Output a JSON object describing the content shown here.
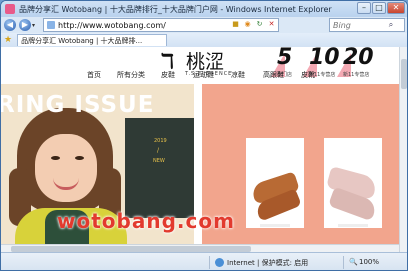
{
  "window": {
    "title": "品牌分享汇 Wotobang | 十大品牌排行_十大品牌门户网 - Windows Internet Explorer",
    "controls": {
      "minimize": "–",
      "maximize": "□",
      "close": "✕"
    }
  },
  "nav": {
    "back": "◀",
    "forward": "▶",
    "dropdown": "▾",
    "url": "http://www.wotobang.com/",
    "search_placeholder": "Bing",
    "search_icon": "⌕"
  },
  "tab": {
    "label": "品牌分享汇 Wotobang | 十大品牌排..."
  },
  "site": {
    "logo_mark": "ℸ",
    "logo_cn": "桃涩",
    "logo_sub": "T.S.ELEGENCE",
    "promos": [
      {
        "num": "5",
        "label": "专门店"
      },
      {
        "num": "10",
        "label": "新11专营店"
      },
      {
        "num": "20",
        "label": "新11专营店"
      }
    ],
    "nav_items": [
      "首页",
      "所有分类",
      "皮鞋",
      "运动鞋",
      "凉鞋",
      "高跟鞋",
      "皮靴"
    ]
  },
  "banner": {
    "headline": "RING ISSUE",
    "year": "2019",
    "slash": "/",
    "new": "NEW",
    "watermark": "wotobang.com"
  },
  "status": {
    "zone": "Internet | 保护模式: 启用",
    "zoom": "100%",
    "zoom_icon": "🔍"
  },
  "colors": {
    "left_panel": "#f2e4cc",
    "right_panel": "#f2a58d",
    "watermark": "#e23a2e"
  }
}
